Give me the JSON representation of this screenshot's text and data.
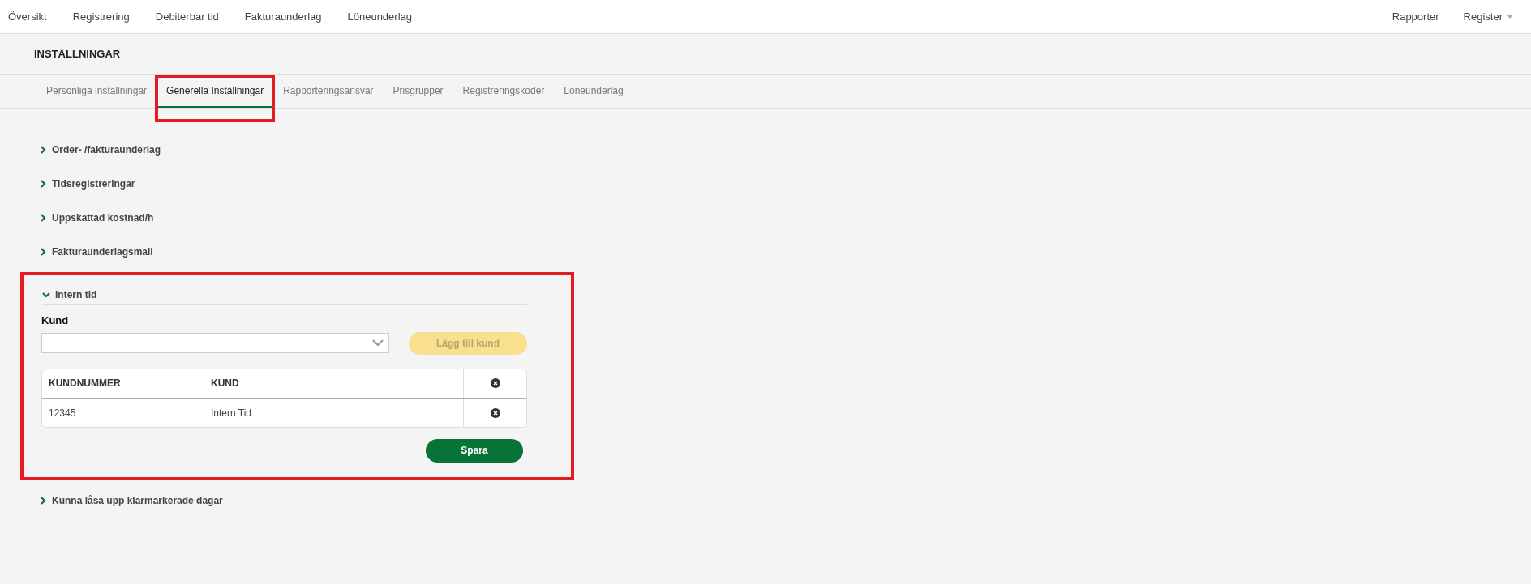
{
  "top_nav": {
    "left": [
      "Översikt",
      "Registrering",
      "Debiterbar tid",
      "Fakturaunderlag",
      "Löneunderlag"
    ],
    "right": [
      {
        "label": "Rapporter",
        "dropdown": false
      },
      {
        "label": "Register",
        "dropdown": true
      }
    ]
  },
  "page_title": "INSTÄLLNINGAR",
  "tabs": [
    {
      "label": "Personliga inställningar",
      "selected": false,
      "highlighted": false
    },
    {
      "label": "Generella Inställningar",
      "selected": true,
      "highlighted": true
    },
    {
      "label": "Rapporteringsansvar",
      "selected": false,
      "highlighted": false
    },
    {
      "label": "Prisgrupper",
      "selected": false,
      "highlighted": false
    },
    {
      "label": "Registreringskoder",
      "selected": false,
      "highlighted": false
    },
    {
      "label": "Löneunderlag",
      "selected": false,
      "highlighted": false
    }
  ],
  "sections": [
    {
      "title": "Order- /fakturaunderlag",
      "expanded": false,
      "highlighted": false
    },
    {
      "title": "Tidsregistreringar",
      "expanded": false,
      "highlighted": false
    },
    {
      "title": "Uppskattad kostnad/h",
      "expanded": false,
      "highlighted": false
    },
    {
      "title": "Fakturaunderlagsmall",
      "expanded": false,
      "highlighted": false
    },
    {
      "title": "Intern tid",
      "expanded": true,
      "highlighted": true,
      "content": {
        "field_label": "Kund",
        "add_button": {
          "label": "Lägg till kund",
          "disabled": true
        },
        "table": {
          "columns": [
            "KUNDNUMMER",
            "KUND"
          ],
          "rows": [
            {
              "cells": [
                "12345",
                "Intern Tid"
              ]
            }
          ]
        },
        "save_button": "Spara"
      }
    },
    {
      "title": "Kunna låsa upp klarmarkerade dagar",
      "expanded": false,
      "highlighted": false
    }
  ]
}
